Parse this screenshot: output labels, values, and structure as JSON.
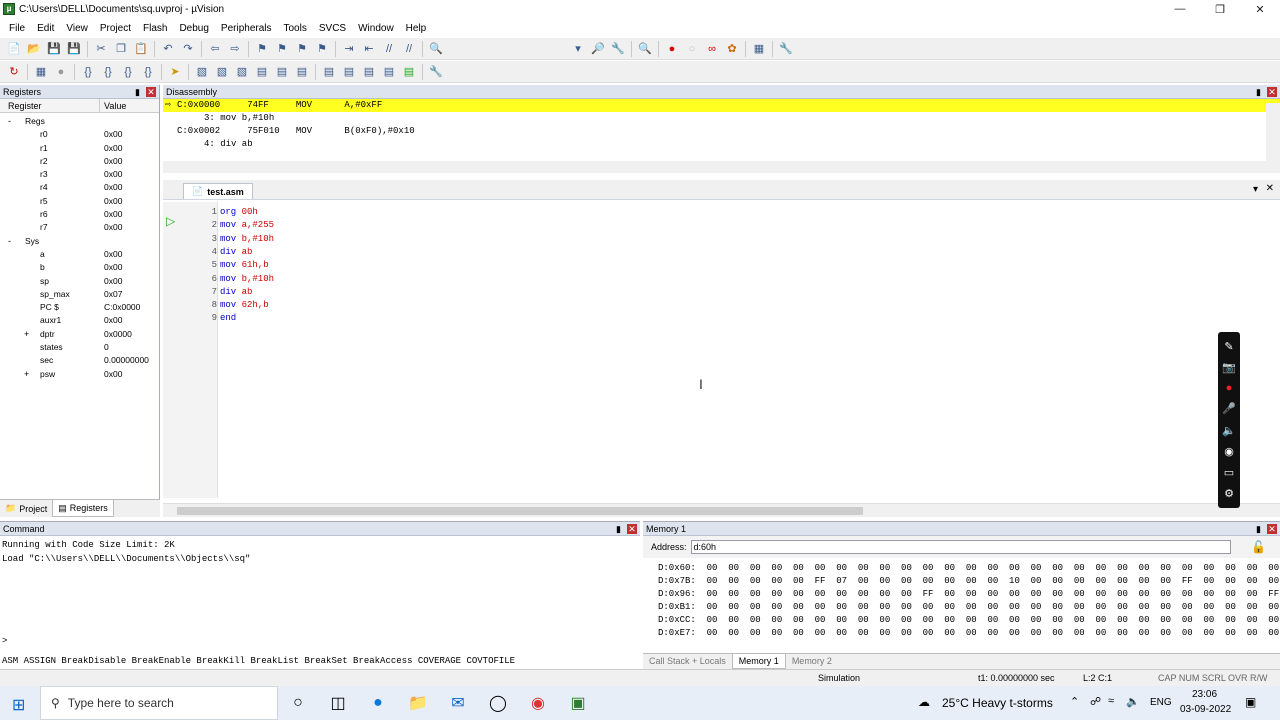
{
  "window": {
    "title": "C:\\Users\\DELL\\Documents\\sq.uvproj - µVision",
    "app_icon": "uvision-icon",
    "controls": [
      "minimize",
      "maximize",
      "close"
    ]
  },
  "menu": [
    "File",
    "Edit",
    "View",
    "Project",
    "Flash",
    "Debug",
    "Peripherals",
    "Tools",
    "SVCS",
    "Window",
    "Help"
  ],
  "registers": {
    "title": "Registers",
    "col_register": "Register",
    "col_value": "Value",
    "rows": [
      {
        "name": "Regs",
        "value": "",
        "tree": "-",
        "indent": 0
      },
      {
        "name": "r0",
        "value": "0x00",
        "tree": "",
        "indent": 2
      },
      {
        "name": "r1",
        "value": "0x00",
        "tree": "",
        "indent": 2
      },
      {
        "name": "r2",
        "value": "0x00",
        "tree": "",
        "indent": 2
      },
      {
        "name": "r3",
        "value": "0x00",
        "tree": "",
        "indent": 2
      },
      {
        "name": "r4",
        "value": "0x00",
        "tree": "",
        "indent": 2
      },
      {
        "name": "r5",
        "value": "0x00",
        "tree": "",
        "indent": 2
      },
      {
        "name": "r6",
        "value": "0x00",
        "tree": "",
        "indent": 2
      },
      {
        "name": "r7",
        "value": "0x00",
        "tree": "",
        "indent": 2
      },
      {
        "name": "Sys",
        "value": "",
        "tree": "-",
        "indent": 0
      },
      {
        "name": "a",
        "value": "0x00",
        "tree": "",
        "indent": 2
      },
      {
        "name": "b",
        "value": "0x00",
        "tree": "",
        "indent": 2
      },
      {
        "name": "sp",
        "value": "0x00",
        "tree": "",
        "indent": 2
      },
      {
        "name": "sp_max",
        "value": "0x07",
        "tree": "",
        "indent": 2
      },
      {
        "name": "PC  $",
        "value": "C:0x0000",
        "tree": "",
        "indent": 2
      },
      {
        "name": "auxr1",
        "value": "0x00",
        "tree": "",
        "indent": 2
      },
      {
        "name": "dptr",
        "value": "0x0000",
        "tree": "+",
        "indent": 2
      },
      {
        "name": "states",
        "value": "0",
        "tree": "",
        "indent": 2
      },
      {
        "name": "sec",
        "value": "0.00000000",
        "tree": "",
        "indent": 2
      },
      {
        "name": "psw",
        "value": "0x00",
        "tree": "+",
        "indent": 2
      }
    ],
    "tabs": [
      {
        "label": "Project",
        "active": false
      },
      {
        "label": "Registers",
        "active": true
      }
    ]
  },
  "disassembly": {
    "title": "Disassembly",
    "lines": [
      {
        "text": "C:0x0000     74FF     MOV      A,#0xFF",
        "highlight": true
      },
      {
        "text": "     3: mov b,#10h",
        "highlight": false
      },
      {
        "text": "C:0x0002     75F010   MOV      B(0xF0),#0x10",
        "highlight": false
      },
      {
        "text": "     4: div ab",
        "highlight": false
      }
    ]
  },
  "editor": {
    "tab": "test.asm",
    "lines": [
      {
        "num": "1",
        "kw": "org",
        "arg": "00h"
      },
      {
        "num": "2",
        "kw": "mov",
        "arg": "a,#255"
      },
      {
        "num": "3",
        "kw": "mov",
        "arg": "b,#10h"
      },
      {
        "num": "4",
        "kw": "div",
        "arg": "ab"
      },
      {
        "num": "5",
        "kw": "mov",
        "arg": "61h,b"
      },
      {
        "num": "6",
        "kw": "mov",
        "arg": "b,#10h"
      },
      {
        "num": "7",
        "kw": "div",
        "arg": "ab"
      },
      {
        "num": "8",
        "kw": "mov",
        "arg": "62h,b"
      },
      {
        "num": "9",
        "kw": "end",
        "arg": ""
      }
    ]
  },
  "command": {
    "title": "Command",
    "output": [
      "Running with Code Size Limit: 2K",
      "Load \"C:\\\\Users\\\\DELL\\\\Documents\\\\Objects\\\\sq\""
    ],
    "prompt": ">",
    "help": "ASM ASSIGN BreakDisable BreakEnable BreakKill BreakList BreakSet BreakAccess COVERAGE COVTOFILE"
  },
  "memory": {
    "title": "Memory 1",
    "address_label": "Address:",
    "address_value": "d:60h",
    "rows": [
      "D:0x60:  00  00  00  00  00  00  00  00  00  00  00  00  00  00  00  00  00  00  00  00  00  00  00  00  00  00  00",
      "D:0x7B:  00  00  00  00  00  FF  07  00  00  00  00  00  00  00  10  00  00  00  00  00  00  00  FF  00  00  00  00",
      "D:0x96:  00  00  00  00  00  00  00  00  00  00  FF  00  00  00  00  00  00  00  00  00  00  00  00  00  00  00  FF",
      "D:0xB1:  00  00  00  00  00  00  00  00  00  00  00  00  00  00  00  00  00  00  00  00  00  00  00  00  00  00  00",
      "D:0xCC:  00  00  00  00  00  00  00  00  00  00  00  00  00  00  00  00  00  00  00  00  00  00  00  00  00  00  00",
      "D:0xE7:  00  00  00  00  00  00  00  00  00  00  00  00  00  00  00  00  00  00  00  00  00  00  00  00  00  00  00"
    ],
    "tabs": [
      {
        "label": "Call Stack + Locals",
        "active": false
      },
      {
        "label": "Memory 1",
        "active": true
      },
      {
        "label": "Memory 2",
        "active": false
      }
    ]
  },
  "status": {
    "mode": "Simulation",
    "time": "t1: 0.00000000 sec",
    "position": "L:2 C:1",
    "indicators": "CAP  NUM  SCRL  OVR  R/W"
  },
  "taskbar": {
    "search_placeholder": "Type here to search",
    "weather": "25°C  Heavy t-storms",
    "lang": "ENG",
    "time": "23:06",
    "date": "03-09-2022"
  },
  "colors": {
    "highlight": "#ffff20",
    "keyword": "#0000cc",
    "operand": "#cc0000"
  }
}
